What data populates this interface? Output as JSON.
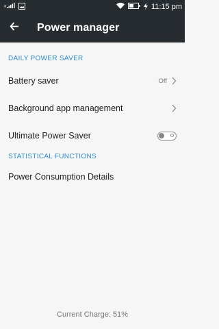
{
  "status_bar": {
    "time": "11:15 pm",
    "icons": [
      "signal-icon",
      "image-notification-icon",
      "wifi-icon",
      "battery-icon",
      "charging-icon"
    ]
  },
  "header": {
    "title": "Power manager",
    "back_icon": "arrow-left-icon"
  },
  "sections": [
    {
      "title": "DAILY POWER SAVER",
      "items": [
        {
          "label": "Battery saver",
          "value": "Off",
          "control": "chevron-right-icon"
        },
        {
          "label": "Background app management",
          "control": "chevron-right-icon"
        },
        {
          "label": "Ultimate Power Saver",
          "control": "toggle",
          "state": "off"
        }
      ]
    },
    {
      "title": "STATISTICAL FUNCTIONS",
      "items": [
        {
          "label": "Power Consumption Details"
        }
      ]
    }
  ],
  "footer": {
    "charge_text": "Current Charge: 51%",
    "charge_percent": 51
  },
  "colors": {
    "appbar": "#262c30",
    "accent": "#2a8cd6",
    "background": "#f6f6f6"
  }
}
